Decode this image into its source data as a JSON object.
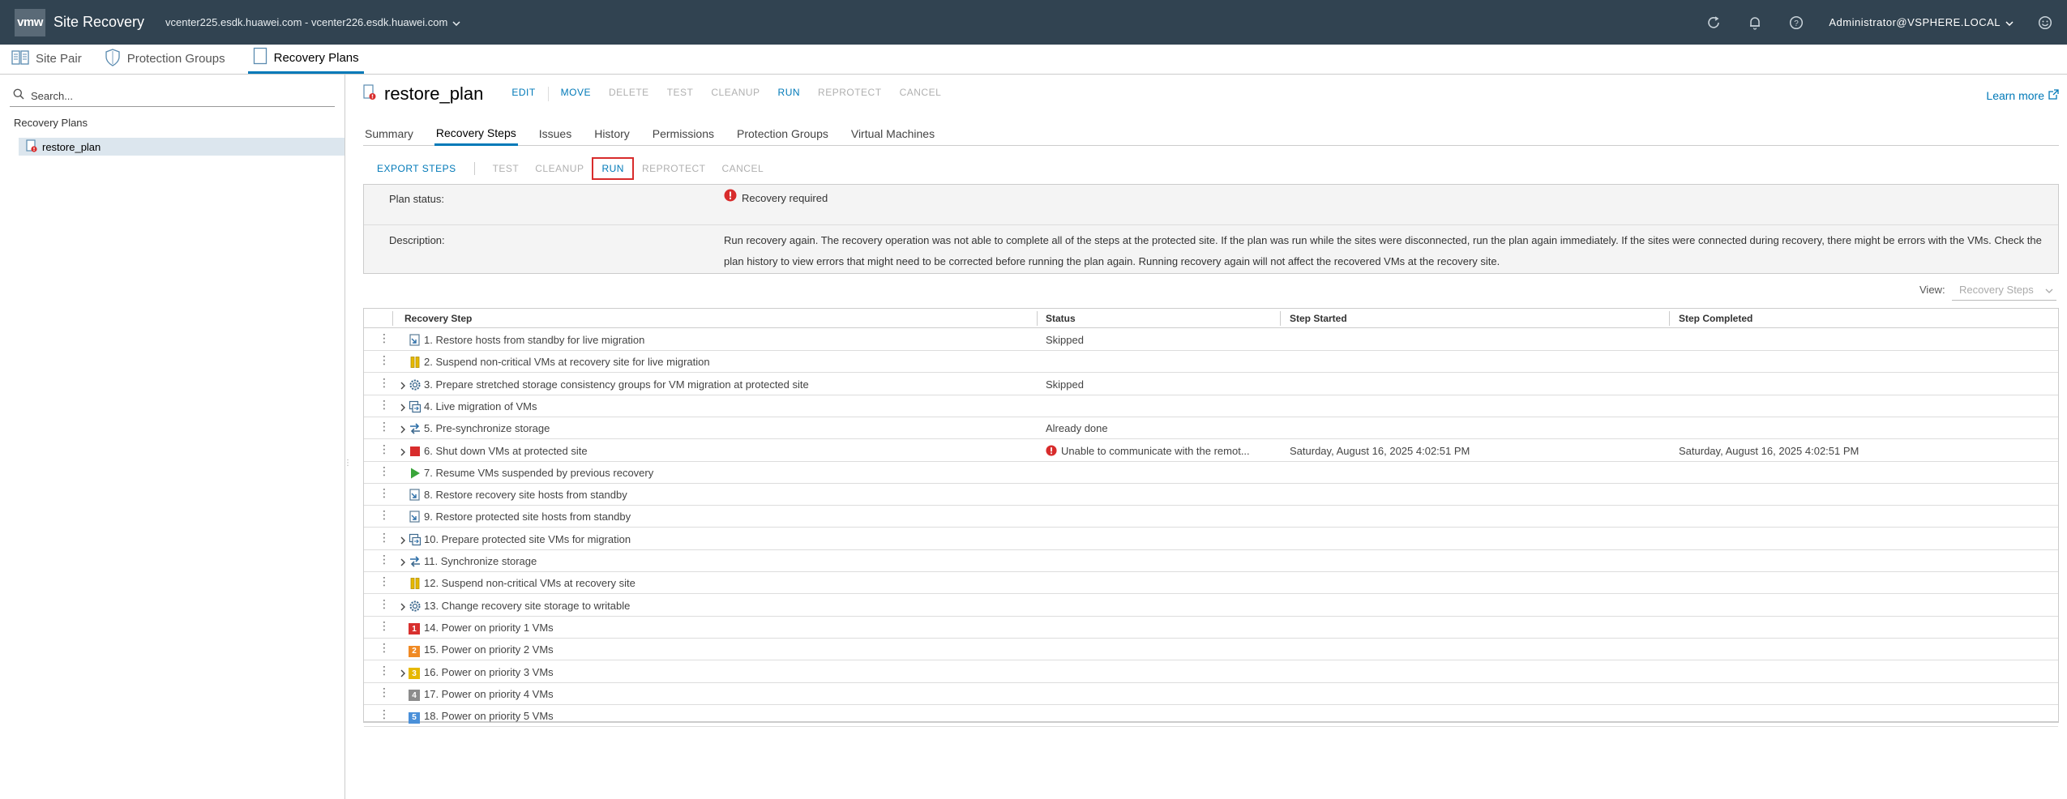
{
  "topbar": {
    "logo": "vmw",
    "app_title": "Site Recovery",
    "vcenter_pair": "vcenter225.esdk.huawei.com - vcenter226.esdk.huawei.com",
    "user": "Administrator@VSPHERE.LOCAL"
  },
  "nav": {
    "tabs": [
      {
        "label": "Site Pair"
      },
      {
        "label": "Protection Groups"
      },
      {
        "label": "Recovery Plans"
      }
    ]
  },
  "left": {
    "search_placeholder": "Search...",
    "heading": "Recovery Plans",
    "item": "restore_plan"
  },
  "plan": {
    "title": "restore_plan",
    "actions": [
      "EDIT",
      "MOVE",
      "DELETE",
      "TEST",
      "CLEANUP",
      "RUN",
      "REPROTECT",
      "CANCEL"
    ],
    "learn_more": "Learn more"
  },
  "subtabs": [
    "Summary",
    "Recovery Steps",
    "Issues",
    "History",
    "Permissions",
    "Protection Groups",
    "Virtual Machines"
  ],
  "toolbar": {
    "export": "EXPORT STEPS",
    "test": "TEST",
    "cleanup": "CLEANUP",
    "run": "RUN",
    "reprotect": "REPROTECT",
    "cancel": "CANCEL"
  },
  "status": {
    "plan_status_label": "Plan status:",
    "plan_status_value": "Recovery required",
    "description_label": "Description:",
    "description_value": "Run recovery again. The recovery operation was not able to complete all of the steps at the protected site. If the plan was run while the sites were disconnected, run the plan again immediately. If the sites were connected during recovery, there might be errors with the VMs. Check the plan history to view errors that might need to be corrected before running the plan again. Running recovery again will not affect the recovered VMs at the recovery site."
  },
  "view": {
    "label": "View:",
    "selected": "Recovery Steps"
  },
  "grid": {
    "columns": [
      "Recovery Step",
      "Status",
      "Step Started",
      "Step Completed"
    ],
    "rows": [
      {
        "step": "1. Restore hosts from standby for live migration",
        "status": "Skipped",
        "started": "",
        "completed": "",
        "icon": "host-standby-icon",
        "expand": false
      },
      {
        "step": "2. Suspend non-critical VMs at recovery site for live migration",
        "status": "",
        "started": "",
        "completed": "",
        "icon": "suspend-icon",
        "expand": false
      },
      {
        "step": "3. Prepare stretched storage consistency groups for VM migration at protected site",
        "status": "Skipped",
        "started": "",
        "completed": "",
        "icon": "gear-icon",
        "expand": true
      },
      {
        "step": "4. Live migration of VMs",
        "status": "",
        "started": "",
        "completed": "",
        "icon": "vm-migrate-icon",
        "expand": true
      },
      {
        "step": "5. Pre-synchronize storage",
        "status": "Already done",
        "started": "",
        "completed": "",
        "icon": "sync-icon",
        "expand": true
      },
      {
        "step": "6. Shut down VMs at protected site",
        "status": "Unable to communicate with the remot...",
        "started": "Saturday, August 16, 2025 4:02:51 PM",
        "completed": "Saturday, August 16, 2025 4:02:51 PM",
        "icon": "stop-icon",
        "expand": true,
        "error": true
      },
      {
        "step": "7. Resume VMs suspended by previous recovery",
        "status": "",
        "started": "",
        "completed": "",
        "icon": "play-icon",
        "expand": false
      },
      {
        "step": "8. Restore recovery site hosts from standby",
        "status": "",
        "started": "",
        "completed": "",
        "icon": "host-standby-icon",
        "expand": false
      },
      {
        "step": "9. Restore protected site hosts from standby",
        "status": "",
        "started": "",
        "completed": "",
        "icon": "host-standby-icon",
        "expand": false
      },
      {
        "step": "10. Prepare protected site VMs for migration",
        "status": "",
        "started": "",
        "completed": "",
        "icon": "vm-migrate-icon",
        "expand": true
      },
      {
        "step": "11. Synchronize storage",
        "status": "",
        "started": "",
        "completed": "",
        "icon": "sync-icon",
        "expand": true
      },
      {
        "step": "12. Suspend non-critical VMs at recovery site",
        "status": "",
        "started": "",
        "completed": "",
        "icon": "suspend-icon",
        "expand": false
      },
      {
        "step": "13. Change recovery site storage to writable",
        "status": "",
        "started": "",
        "completed": "",
        "icon": "gear-icon",
        "expand": true
      },
      {
        "step": "14. Power on priority 1 VMs",
        "status": "",
        "started": "",
        "completed": "",
        "icon": "priority-1-icon",
        "expand": false,
        "prio": "1",
        "prio_color": "#d8302e"
      },
      {
        "step": "15. Power on priority 2 VMs",
        "status": "",
        "started": "",
        "completed": "",
        "icon": "priority-2-icon",
        "expand": false,
        "prio": "2",
        "prio_color": "#f08a24"
      },
      {
        "step": "16. Power on priority 3 VMs",
        "status": "",
        "started": "",
        "completed": "",
        "icon": "priority-3-icon",
        "expand": true,
        "prio": "3",
        "prio_color": "#e6b800"
      },
      {
        "step": "17. Power on priority 4 VMs",
        "status": "",
        "started": "",
        "completed": "",
        "icon": "priority-4-icon",
        "expand": false,
        "prio": "4",
        "prio_color": "#8c8c8c"
      },
      {
        "step": "18. Power on priority 5 VMs",
        "status": "",
        "started": "",
        "completed": "",
        "icon": "priority-5-icon",
        "expand": false,
        "prio": "5",
        "prio_color": "#4a90d9"
      }
    ]
  },
  "colors": {
    "header_bg": "#314351",
    "accent": "#0079b8",
    "error": "#d82c2c"
  }
}
